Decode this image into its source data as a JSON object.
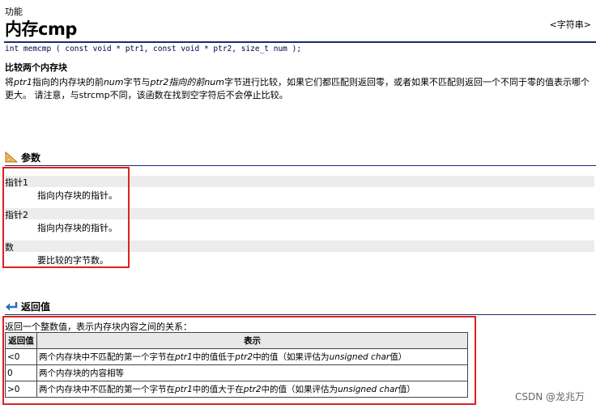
{
  "header": {
    "section": "功能",
    "title": "内存cmp",
    "tag": "<字符串>"
  },
  "prototype": "int memcmp ( const void * ptr1, const void * ptr2, size_t num );",
  "summary": "比较两个内存块",
  "description": {
    "line1_a": "将",
    "ptr1": "ptr1",
    "line1_b": "指向的内存块的前",
    "num": "num",
    "line1_c": "字节与",
    "ptr2_phrase": "ptr2指向的前",
    "num2": "num",
    "line1_d": "字节进行比较，如果它们都匹配则返回零，或者如果不匹配则返回一个不同于零的值表示哪个更大。 请注意，与",
    "strcmp": "strcmp",
    "line1_e": "不同，该函数在找到空字符后不会停止比较。"
  },
  "params_section": {
    "heading": "参数",
    "items": [
      {
        "name": "指针1",
        "desc": "指向内存块的指针。"
      },
      {
        "name": "指针2",
        "desc": "指向内存块的指针。"
      },
      {
        "name": "数",
        "desc": "要比较的字节数。"
      }
    ]
  },
  "return_section": {
    "heading": "返回值",
    "intro": "返回一个整数值，表示内存块内容之间的关系：",
    "columns": [
      "返回值",
      "表示"
    ],
    "rows": [
      {
        "value": "<0",
        "meaning_a": "两个内存块中不匹配的第一个字节在",
        "ptr1": "ptr1",
        "meaning_b": "中的值低于",
        "ptr2": "ptr2",
        "meaning_c": "中的值（如果评估为",
        "uc": "unsigned char",
        "meaning_d": "值）"
      },
      {
        "value": "0",
        "meaning_a": "两个内存块的内容相等",
        "ptr1": "",
        "meaning_b": "",
        "ptr2": "",
        "meaning_c": "",
        "uc": "",
        "meaning_d": ""
      },
      {
        "value": ">0",
        "meaning_a": "两个内存块中不匹配的第一个字节在",
        "ptr1": "ptr1",
        "meaning_b": "中的值大于在",
        "ptr2": "ptr2",
        "meaning_c": "中的值（如果评估为",
        "uc": "unsigned char",
        "meaning_d": "值）"
      }
    ]
  },
  "watermark": "CSDN @龙兆万",
  "colors": {
    "rule": "#1a2b6b",
    "highlight_box": "#e02020",
    "param_band": "#ececec"
  }
}
